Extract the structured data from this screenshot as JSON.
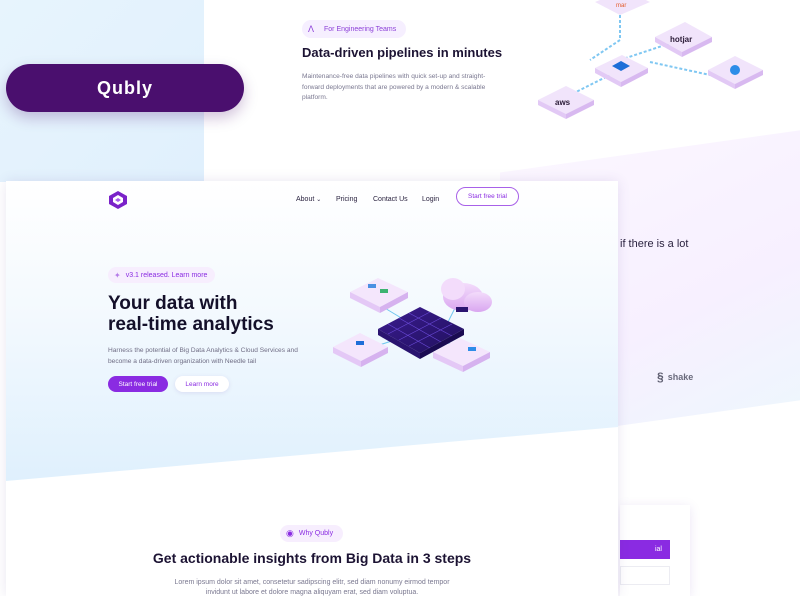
{
  "back_page": {
    "badge": "For Engineering Teams",
    "title": "Data-driven pipelines in minutes",
    "description": "Maintenance-free data pipelines with quick set-up and straight-forward deployments that are powered by a modern & scalable platform.",
    "text_fragment": "if there is a lot",
    "partner_logo": "shake",
    "partner_logo_fragment": "e",
    "card_button_fragment": "ial",
    "integration_logos": [
      "aws",
      "hotjar"
    ]
  },
  "overlay": {
    "brand_label": "Qubly"
  },
  "main_page": {
    "nav": {
      "about": "About",
      "pricing": "Pricing",
      "contact": "Contact Us",
      "login": "Login",
      "cta": "Start free trial"
    },
    "hero": {
      "badge": "v3.1 released. Learn more",
      "title_line1": "Your data with",
      "title_line2": "real-time analytics",
      "description": "Harness the potential of Big Data Analytics & Cloud Services and become a data-driven organization with Needle tail",
      "primary_button": "Start free trial",
      "secondary_button": "Learn more"
    },
    "why": {
      "badge": "Why Qubly",
      "title": "Get actionable insights from Big Data in 3 steps",
      "description": "Lorem ipsum dolor sit amet, consetetur sadipscing elitr, sed diam nonumy eirmod tempor invidunt ut labore et dolore magna aliquyam erat, sed diam voluptua."
    }
  },
  "colors": {
    "brand_purple": "#8a2be2",
    "pill_purple": "#4a0f6e",
    "hero_blue": "#dff0fd"
  }
}
